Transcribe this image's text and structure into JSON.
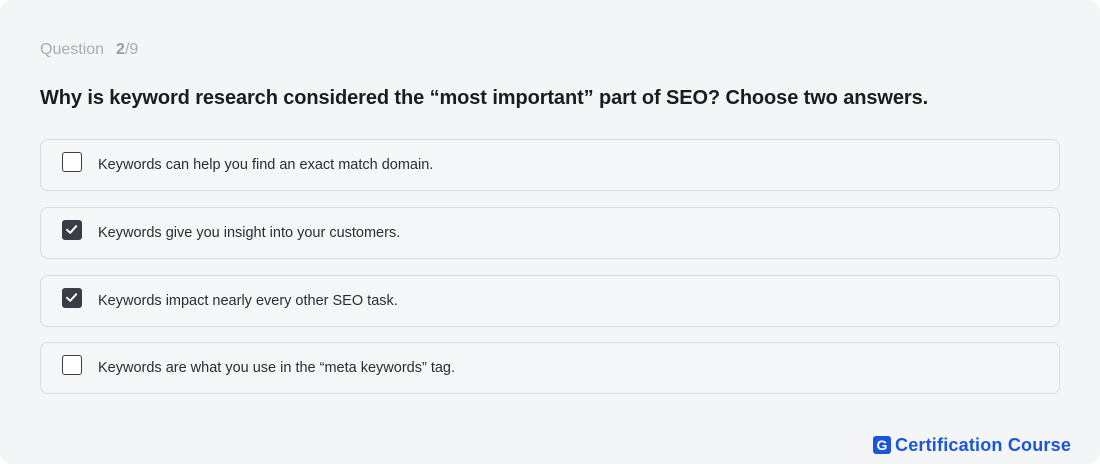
{
  "quiz": {
    "counter_word": "Question",
    "current": "2",
    "total": "/9",
    "title": "Why is keyword research considered the “most important” part of SEO? Choose two answers.",
    "options": [
      {
        "label": "Keywords can help you find an exact match domain.",
        "checked": false
      },
      {
        "label": "Keywords give you insight into your customers.",
        "checked": true
      },
      {
        "label": "Keywords impact nearly every other SEO task.",
        "checked": true
      },
      {
        "label": "Keywords are what you use in the “meta keywords” tag.",
        "checked": false
      }
    ]
  },
  "brand": {
    "logo_letter": "G",
    "name": "Certification Course",
    "color": "#1a56db"
  },
  "colors": {
    "checkbox_checked": "#3a3d45",
    "card_background": "#f4f5f7"
  }
}
